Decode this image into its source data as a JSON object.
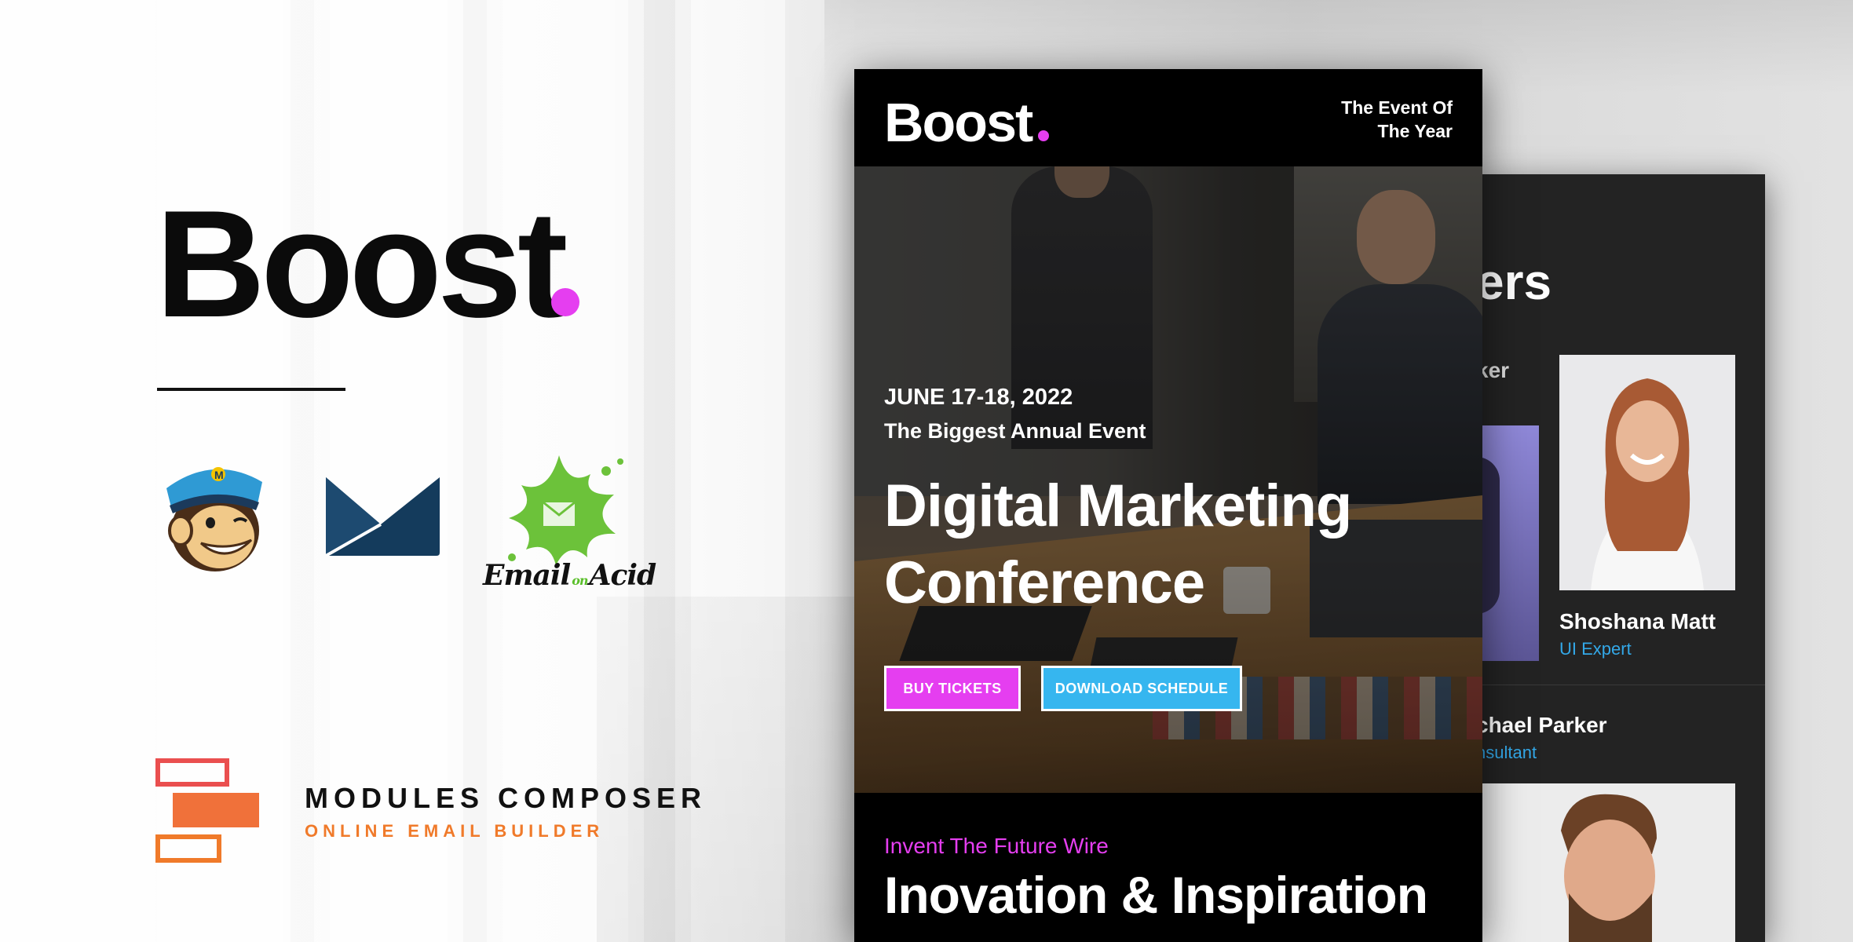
{
  "brand": {
    "name": "Boost",
    "accent_color": "#e53ef0"
  },
  "integrations": {
    "items": [
      "mailchimp-logo",
      "postmark-logo",
      "email-on-acid-logo"
    ],
    "email_on_acid": {
      "word1": "Email",
      "word2": "on",
      "word3": "Acid"
    }
  },
  "modules_composer": {
    "title": "MODULES COMPOSER",
    "subtitle": "ONLINE EMAIL BUILDER"
  },
  "email_preview": {
    "header": {
      "logo": "Boost",
      "tagline_line1": "The Event Of",
      "tagline_line2": "The Year"
    },
    "hero": {
      "date": "JUNE 17-18, 2022",
      "event": "The Biggest Annual Event",
      "title_line1": "Digital Marketing",
      "title_line2": "Conference",
      "buy_button": "BUY TICKETS",
      "download_button": "DOWNLOAD SCHEDULE",
      "buy_color": "#e53ef0",
      "download_color": "#36b6ef"
    },
    "section": {
      "kicker": "Invent The Future Wire",
      "title": "Inovation & Inspiration"
    }
  },
  "speakers_preview": {
    "heading_fragment": "ers",
    "sub_fragment": "ker",
    "speaker1": {
      "name": "Shoshana Matt",
      "role": "UI Expert"
    },
    "speaker2": {
      "name": "chael Parker",
      "role": "nsultant"
    },
    "role_color": "#33a8e8"
  }
}
